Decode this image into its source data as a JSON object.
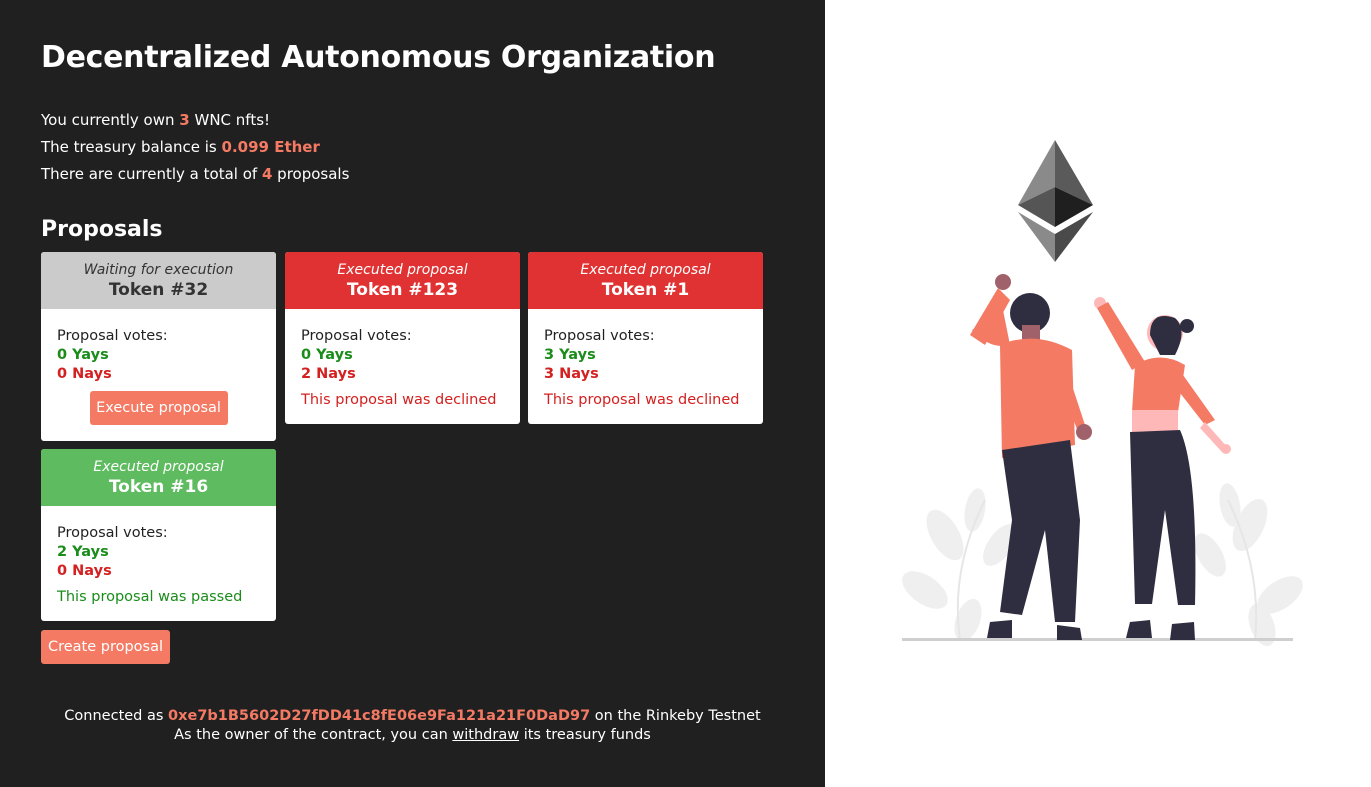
{
  "header": {
    "title": "Decentralized Autonomous Organization"
  },
  "stats": {
    "own_prefix": "You currently own",
    "nft_count": "3",
    "own_suffix": "WNC nfts!",
    "treasury_prefix": "The treasury balance is",
    "treasury_value": "0.099 Ether",
    "total_prefix": "There are currently a total of",
    "proposal_count": "4",
    "total_suffix": "proposals"
  },
  "proposals": {
    "heading": "Proposals",
    "votes_label": "Proposal votes:",
    "items": [
      {
        "status": "Waiting for execution",
        "token": "Token #32",
        "yays": "0 Yays",
        "nays": "0 Nays",
        "action_label": "Execute proposal",
        "head_color": "#cbcbcb"
      },
      {
        "status": "Executed proposal",
        "token": "Token #123",
        "yays": "0 Yays",
        "nays": "2 Nays",
        "result": "This proposal was declined",
        "head_color": "#e03232"
      },
      {
        "status": "Executed proposal",
        "token": "Token #1",
        "yays": "3 Yays",
        "nays": "3 Nays",
        "result": "This proposal was declined",
        "head_color": "#e03232"
      },
      {
        "status": "Executed proposal",
        "token": "Token #16",
        "yays": "2 Yays",
        "nays": "0 Nays",
        "result": "This proposal was passed",
        "head_color": "#5fbb5f"
      }
    ],
    "create_label": "Create proposal"
  },
  "footer": {
    "connected_prefix": "Connected as",
    "address": "0xe7b1B5602D27fDD41c8fE06e9Fa121a21F0DaD97",
    "connected_suffix": "on the Rinkeby Testnet",
    "owner_prefix": "As the owner of the contract, you can",
    "withdraw_label": "withdraw",
    "owner_suffix": "its treasury funds"
  },
  "illustration": {
    "icon": "ethereum-icon",
    "accent": "#f47a64"
  },
  "colors": {
    "background_dark": "#202020",
    "accent": "#f47a64",
    "yays": "#1a8c1a",
    "nays": "#d42020"
  }
}
